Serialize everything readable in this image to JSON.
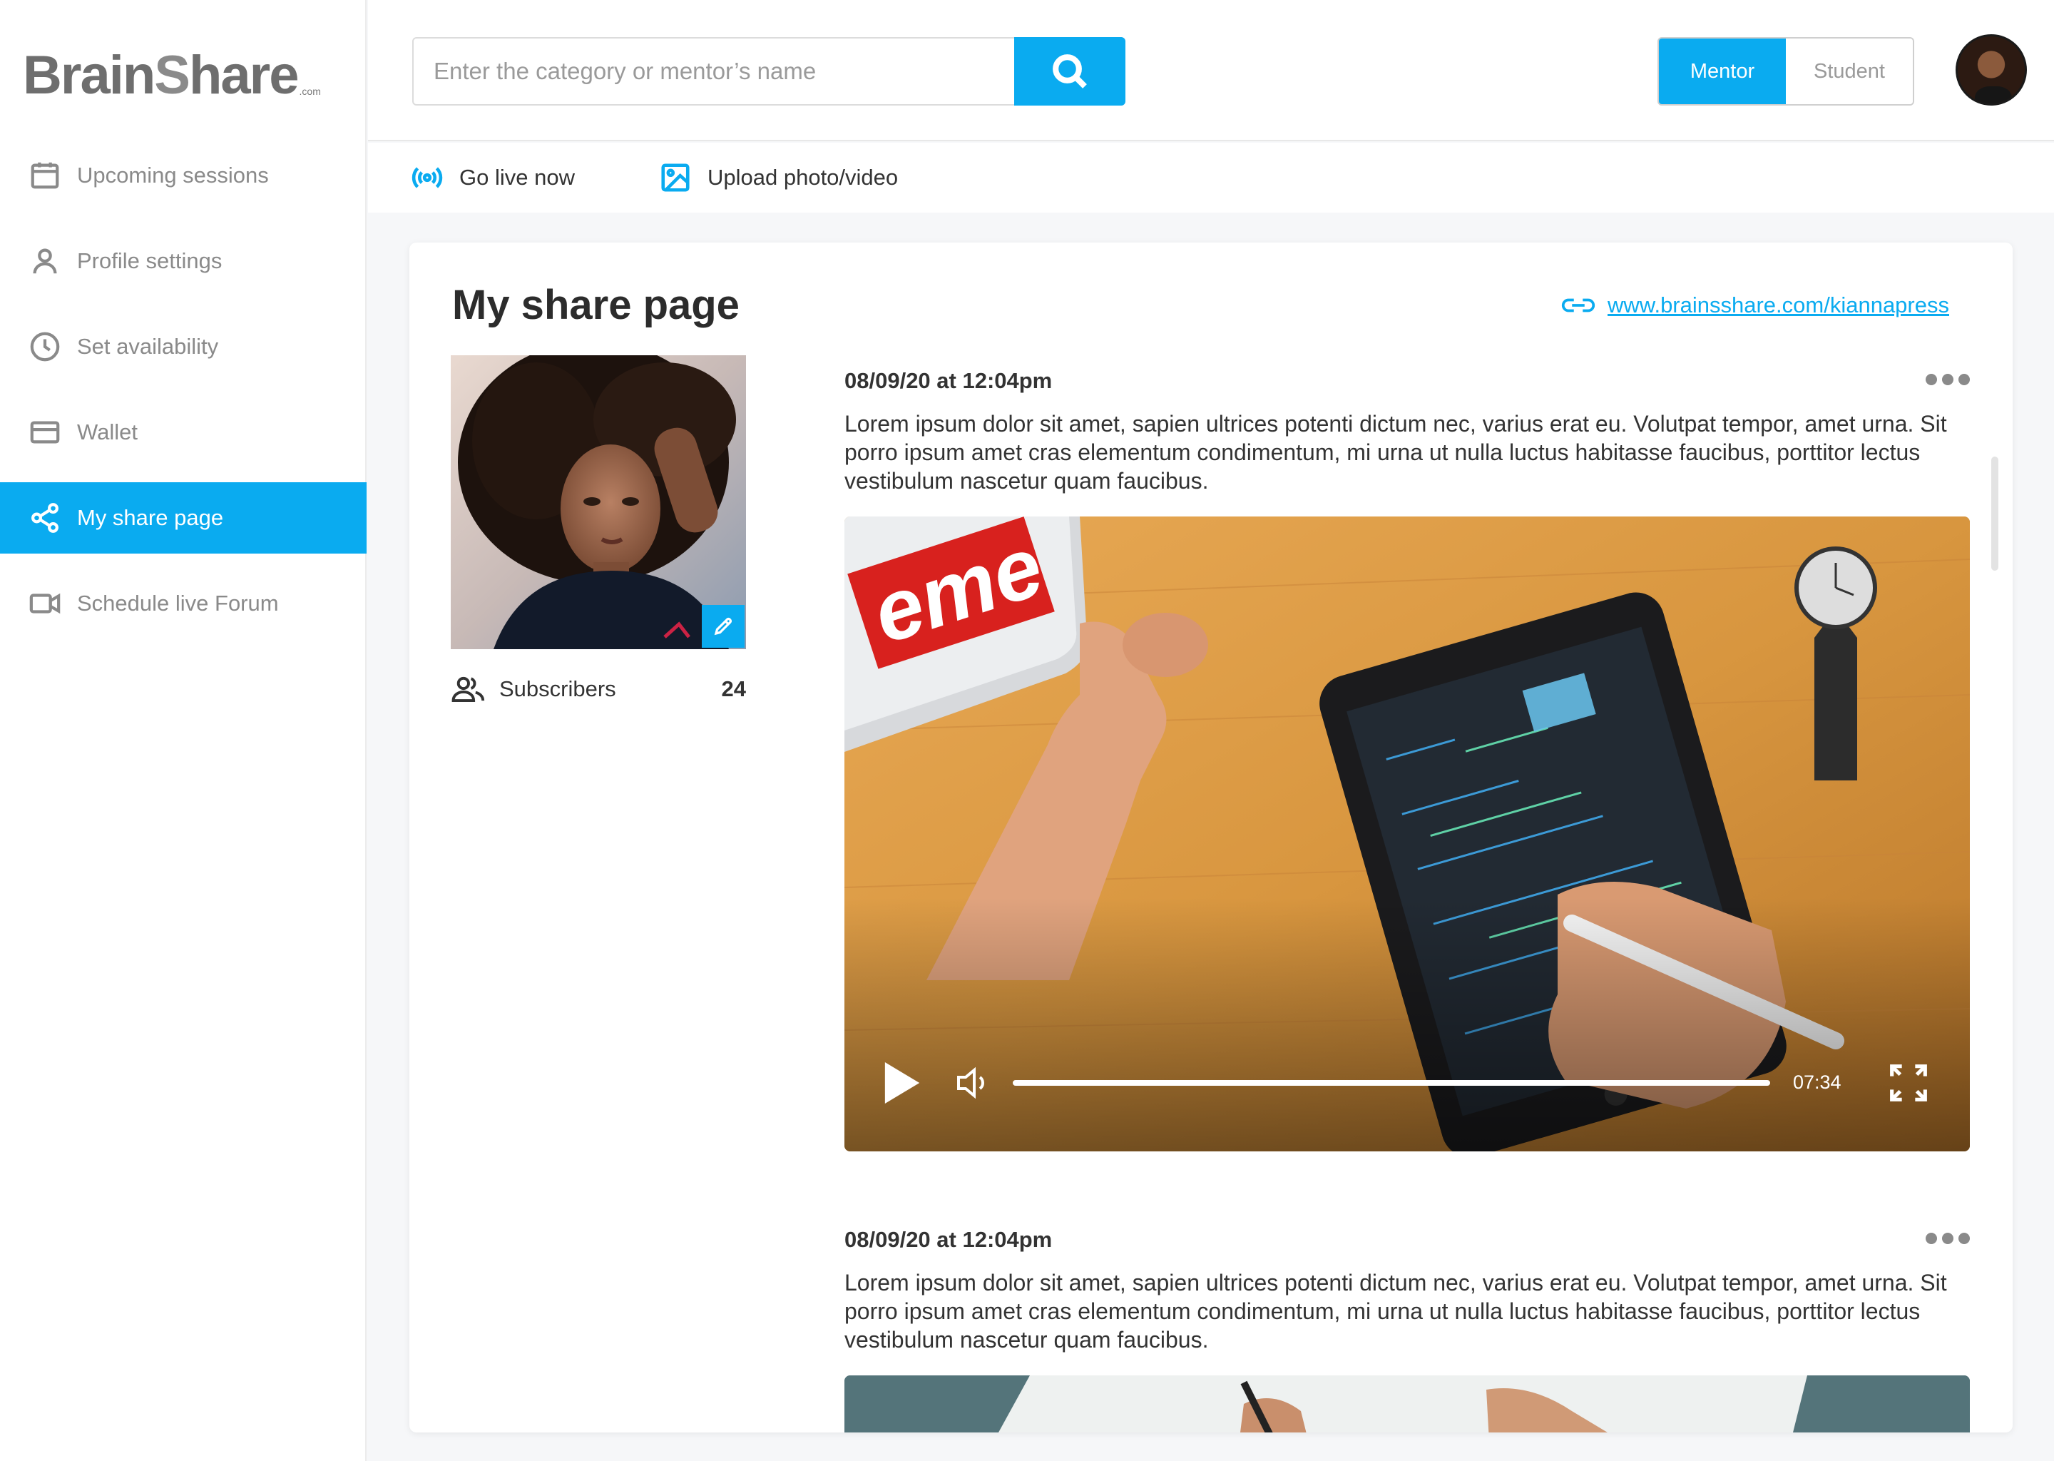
{
  "brand": {
    "name_part1": "Brain",
    "name_part2": "S",
    "name_part3": "hare",
    "suffix": ".com"
  },
  "sidebar": {
    "items": [
      {
        "label": "Upcoming sessions",
        "icon": "calendar-icon",
        "active": false
      },
      {
        "label": "Profile settings",
        "icon": "user-icon",
        "active": false
      },
      {
        "label": "Set availability",
        "icon": "clock-icon",
        "active": false
      },
      {
        "label": "Wallet",
        "icon": "credit-card-icon",
        "active": false
      },
      {
        "label": "My share page",
        "icon": "share-icon",
        "active": true
      },
      {
        "label": "Schedule live Forum",
        "icon": "video-camera-icon",
        "active": false
      }
    ]
  },
  "header": {
    "search_placeholder": "Enter the category or mentor’s name",
    "search_icon": "search-icon",
    "role_toggle": {
      "mentor_label": "Mentor",
      "student_label": "Student",
      "selected": "Mentor"
    }
  },
  "actions": {
    "go_live_label": "Go live now",
    "upload_label": "Upload photo/video"
  },
  "share_page": {
    "title": "My share page",
    "link": "www.brainsshare.com/kiannapress",
    "subscribers_label": "Subscribers",
    "subscribers_count": "24"
  },
  "posts": [
    {
      "date": "08/09/20 at 12:04pm",
      "text": "Lorem ipsum dolor sit amet, sapien ultrices potenti dictum nec, varius erat eu. Volutpat tempor, amet urna. Sit porro ipsum amet cras elementum condimentum, mi urna ut nulla luctus habitasse faucibus, porttitor lectus vestibulum nascetur quam faucibus.",
      "video": {
        "duration": "07:34",
        "progress": 0.0
      }
    },
    {
      "date": "08/09/20 at 12:04pm",
      "text": "Lorem ipsum dolor sit amet, sapien ultrices potenti dictum nec, varius erat eu. Volutpat tempor, amet urna. Sit porro ipsum amet cras elementum condimentum, mi urna ut nulla luctus habitasse faucibus, porttitor lectus vestibulum nascetur quam faucibus."
    }
  ],
  "colors": {
    "accent": "#0aabf0",
    "text": "#333333",
    "muted": "#8a8a8a"
  }
}
